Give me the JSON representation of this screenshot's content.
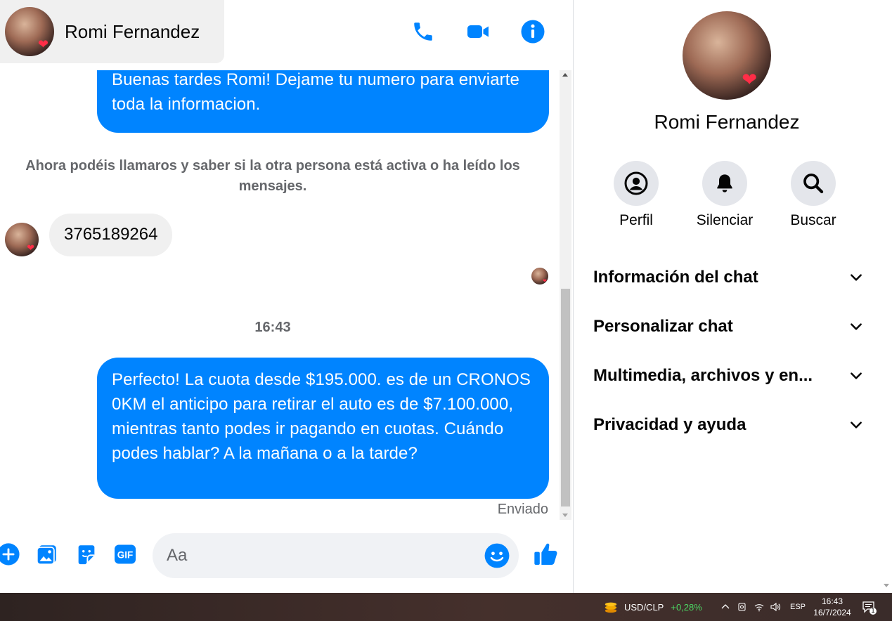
{
  "header": {
    "contact_name": "Romi Fernandez"
  },
  "messages": {
    "outgoing_1": "Buenas tardes Romi! Dejame tu numero para enviarte toda la informacion.",
    "system_note": "Ahora podéis llamaros y saber si la otra persona está activa o ha leído los mensajes.",
    "incoming_1": "3765189264",
    "time_separator": "16:43",
    "outgoing_2": "Perfecto! La cuota desde $195.000. es de un CRONOS 0KM el anticipo para retirar el auto es de $7.100.000, mientras tanto podes ir pagando en cuotas. Cuándo podes hablar? A la mañana o a la tarde?",
    "status": "Enviado"
  },
  "composer": {
    "placeholder": "Aa"
  },
  "info_panel": {
    "name": "Romi Fernandez",
    "actions": [
      {
        "label": "Perfil",
        "icon": "profile-icon"
      },
      {
        "label": "Silenciar",
        "icon": "bell-icon"
      },
      {
        "label": "Buscar",
        "icon": "search-icon"
      }
    ],
    "sections": [
      {
        "label": "Información del chat"
      },
      {
        "label": "Personalizar chat"
      },
      {
        "label": "Multimedia, archivos y en..."
      },
      {
        "label": "Privacidad y ayuda"
      }
    ]
  },
  "taskbar": {
    "ticker_label": "USD/CLP",
    "ticker_change": "+0,28%",
    "language": "ESP",
    "time": "16:43",
    "date": "16/7/2024",
    "notification_count": "1"
  },
  "colors": {
    "messenger_blue": "#0084ff",
    "incoming_bubble": "#f0f0f0",
    "secondary_text": "#65676b",
    "positive_change": "#4cd964"
  }
}
